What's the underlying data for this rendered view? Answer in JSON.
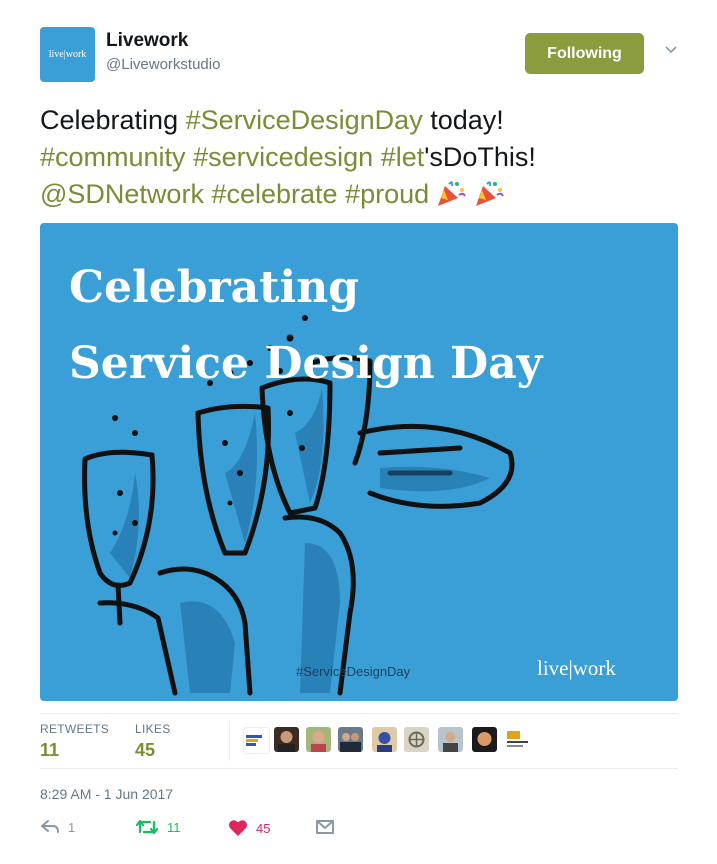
{
  "profile": {
    "avatar_text": "live|work",
    "display_name": "Livework",
    "handle": "@Liveworkstudio",
    "follow_label": "Following"
  },
  "tweet": {
    "segments": [
      {
        "text": "Celebrating ",
        "tag": false
      },
      {
        "text": "#ServiceDesignDay",
        "tag": true
      },
      {
        "text": " today!",
        "tag": false
      },
      {
        "text": "#community",
        "tag": true
      },
      {
        "text": " ",
        "tag": false
      },
      {
        "text": "#servicedesign",
        "tag": true
      },
      {
        "text": " ",
        "tag": false
      },
      {
        "text": "#let",
        "tag": true
      },
      {
        "text": "'sDoThis!",
        "tag": false
      },
      {
        "text": "@SDNetwork",
        "tag": true
      },
      {
        "text": " ",
        "tag": false
      },
      {
        "text": "#celebrate",
        "tag": true
      },
      {
        "text": " ",
        "tag": false
      },
      {
        "text": "#proud",
        "tag": true
      }
    ],
    "emoji": [
      "party-popper-icon",
      "party-popper-icon"
    ]
  },
  "media": {
    "title_line1": "Celebrating",
    "title_line2": "Service Design Day",
    "hashtag": "#ServiceDesignDay",
    "logo": "live|work",
    "bg_color": "#3a9fd6"
  },
  "stats": {
    "retweets_label": "RETWEETS",
    "retweets_value": "11",
    "likes_label": "LIKES",
    "likes_value": "45"
  },
  "timestamp": "8:29 AM - 1 Jun 2017",
  "actions": {
    "reply_count": "1",
    "retweet_count": "11",
    "like_count": "45"
  },
  "colors": {
    "accent": "#7c8b36",
    "follow_button": "#8a9c3e",
    "like": "#e0245e",
    "retweet": "#17bf63"
  }
}
